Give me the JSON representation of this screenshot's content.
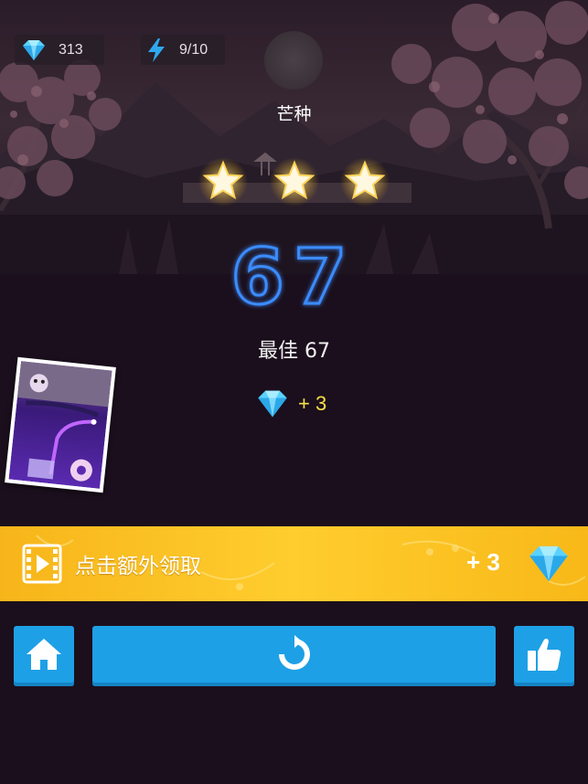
{
  "hud": {
    "gems": "313",
    "energy": "9/10"
  },
  "result": {
    "song_title": "芒种",
    "stars_earned": 3,
    "stars_total": 3,
    "score": "67",
    "best_label": "最佳 67",
    "gem_reward": "+ 3"
  },
  "ad_banner": {
    "label": "点击额外领取",
    "bonus": "+ 3"
  },
  "buttons": {
    "home": "home-icon",
    "retry": "retry-icon",
    "like": "thumbs-up-icon"
  },
  "colors": {
    "background": "#1b0f1d",
    "score_neon": "#3a8cff",
    "banner": "#ffc526",
    "button": "#1ea0e6",
    "reward_text": "#f8e046"
  }
}
